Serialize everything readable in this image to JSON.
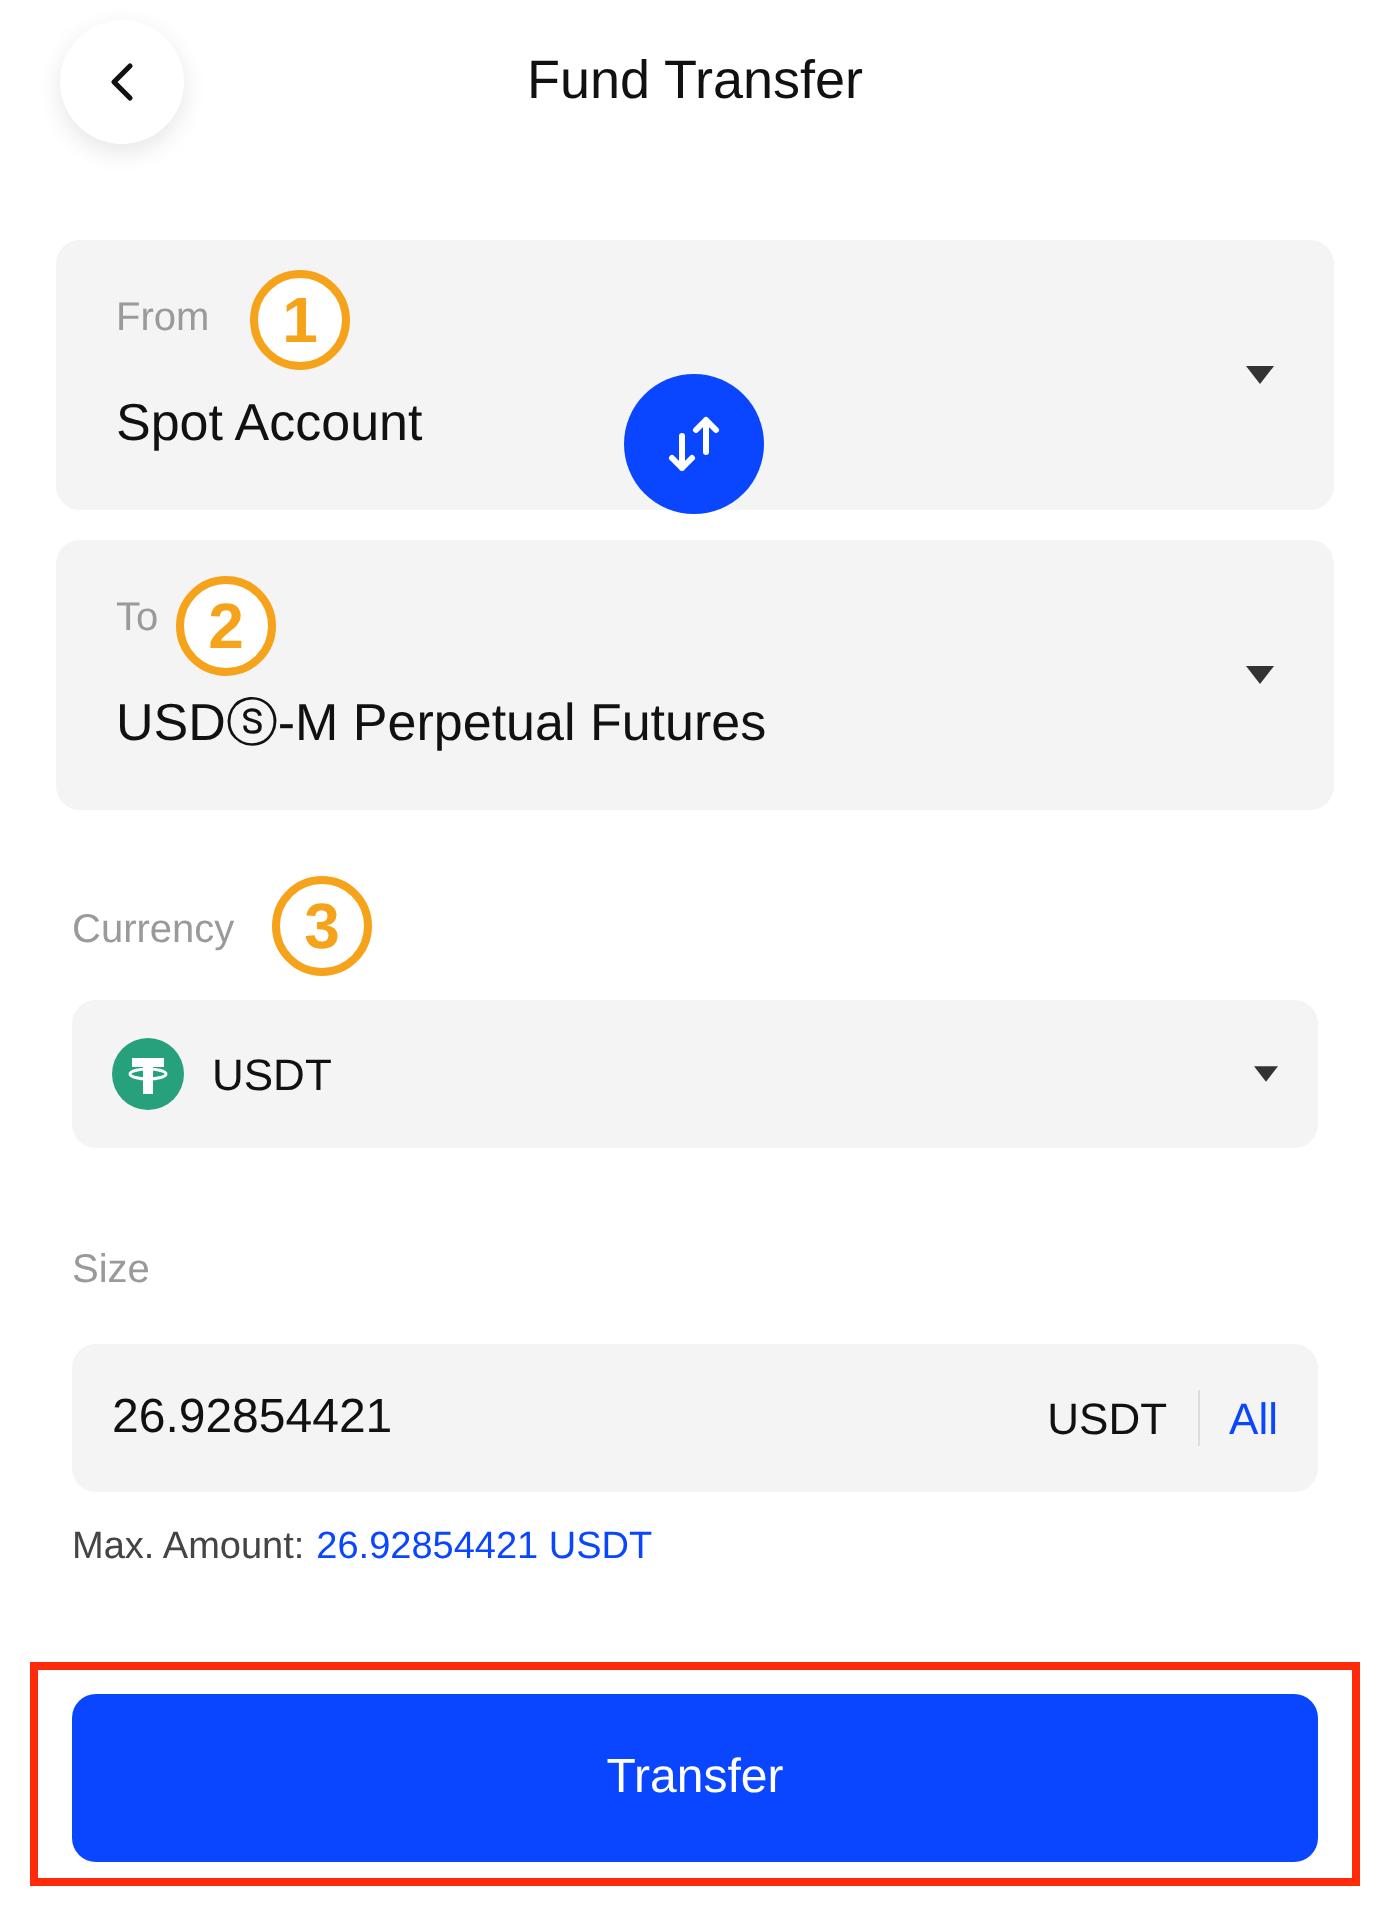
{
  "header": {
    "title": "Fund Transfer"
  },
  "from": {
    "label": "From",
    "step": "1",
    "value": "Spot Account"
  },
  "to": {
    "label": "To",
    "step": "2",
    "value": "USDⓢ-M Perpetual Futures"
  },
  "currency": {
    "label": "Currency",
    "step": "3",
    "value": "USDT"
  },
  "size": {
    "label": "Size",
    "value": "26.92854421",
    "unit": "USDT",
    "all": "All"
  },
  "max_amount": {
    "label": "Max. Amount:",
    "value": "26.92854421 USDT"
  },
  "transfer_button": {
    "label": "Transfer",
    "highlighted": true
  }
}
